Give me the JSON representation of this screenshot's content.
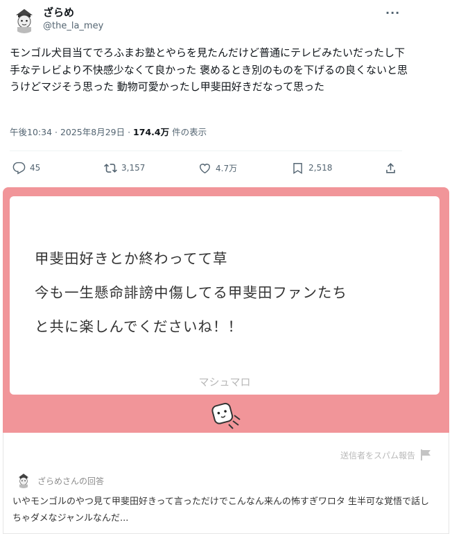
{
  "post": {
    "display_name": "ざらめ",
    "handle": "@the_la_mey",
    "more_icon": "···",
    "text": "モンゴル犬目当てでろふまお塾とやらを見たんだけど普通にテレビみたいだったし下手なテレビより不快感少なくて良かった 褒めるとき別のものを下げるの良くないと思うけどマジそう思った 動物可愛かったし甲斐田好きだなって思った",
    "time": "午後10:34 · 2025年8月29日 · ",
    "views_value": "174.4万",
    "views_suffix": " 件の表示"
  },
  "actions": {
    "reply": {
      "icon": "reply-icon",
      "count": "45"
    },
    "repost": {
      "icon": "repost-icon",
      "count": "3,157"
    },
    "like": {
      "icon": "heart-icon",
      "count": "4.7万"
    },
    "bookmark": {
      "icon": "bookmark-icon",
      "count": "2,518"
    },
    "share": {
      "icon": "share-icon"
    }
  },
  "image": {
    "accent_color": "#f19599",
    "question_lines": [
      "甲斐田好きとか終わってて草",
      "今も一生懸命誹謗中傷してる甲斐田ファンたち",
      "と共に楽しんでくださいね！！"
    ],
    "watermark": "マシュマロ",
    "report_label": "送信者をスパム報告",
    "answer_label": "ざらめさんの回答",
    "answer_text": "いやモンゴルのやつ見て甲斐田好きって言っただけでこんなん来んの怖すぎワロタ 生半可な覚悟で話しちゃダメなジャンルなんだ..."
  }
}
